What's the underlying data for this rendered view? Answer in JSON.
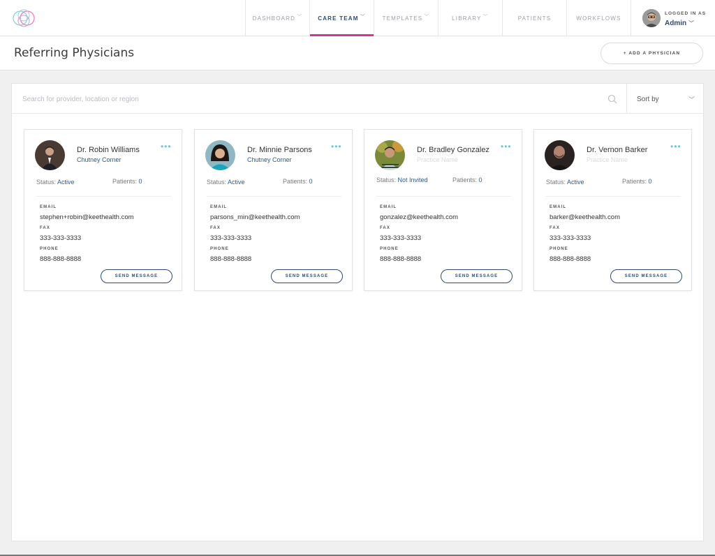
{
  "nav": {
    "items": [
      {
        "label": "DASHBOARD",
        "chevron": true
      },
      {
        "label": "CARE TEAM",
        "chevron": true,
        "active": true
      },
      {
        "label": "TEMPLATES",
        "chevron": true
      },
      {
        "label": "LIBRARY",
        "chevron": true
      },
      {
        "label": "PATIENTS",
        "chevron": false
      },
      {
        "label": "WORKFLOWS",
        "chevron": false
      }
    ],
    "user": {
      "logged_in_label": "LOGGED IN AS",
      "name": "Admin"
    }
  },
  "page": {
    "title": "Referring Physicians",
    "add_button": "+ ADD A PHYSICIAN"
  },
  "search": {
    "placeholder": "Search for provider, location or region",
    "sort_label": "Sort by"
  },
  "labels": {
    "status": "Status:",
    "patients": "Patients:",
    "email": "EMAIL",
    "fax": "FAX",
    "phone": "PHONE",
    "send": "SEND MESSAGE"
  },
  "physicians": [
    {
      "name": "Dr. Robin Williams",
      "practice": "Chutney Corner",
      "status": "Active",
      "patients": "0",
      "email": "stephen+robin@keethealth.com",
      "fax": "333-333-3333",
      "phone": "888-888-8888"
    },
    {
      "name": "Dr. Minnie Parsons",
      "practice": "Chutney Corner",
      "status": "Active",
      "patients": "0",
      "email": "parsons_min@keethealth.com",
      "fax": "333-333-3333",
      "phone": "888-888-8888"
    },
    {
      "name": "Dr. Bradley Gonzalez",
      "practice": "Practice Name",
      "status": "Not Invited",
      "patients": "0",
      "email": "gonzalez@keethealth.com",
      "fax": "333-333-3333",
      "phone": "888-888-8888"
    },
    {
      "name": "Dr. Vernon Barker",
      "practice": "Practice Name",
      "status": "Active",
      "patients": "0",
      "email": "barker@keethealth.com",
      "fax": "333-333-3333",
      "phone": "888-888-8888"
    }
  ],
  "colors": {
    "accent_pink": "#d8358f",
    "navy": "#2f4a6d",
    "link_blue": "#2f5a8a",
    "dots_teal": "#6cc6d3"
  }
}
